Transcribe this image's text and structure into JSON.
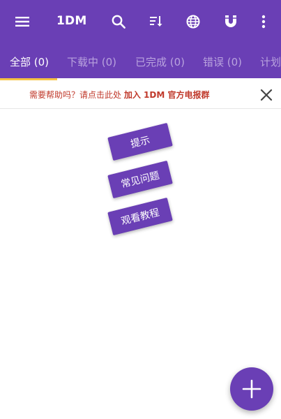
{
  "app": {
    "title": "1DM"
  },
  "toolbar": {
    "icons": [
      "menu-icon",
      "search-icon",
      "sort-icon",
      "browser-icon",
      "magnet-icon",
      "more-vert-icon"
    ]
  },
  "tabs": [
    {
      "label": "全部 (0)",
      "active": true
    },
    {
      "label": "下载中 (0)",
      "active": false
    },
    {
      "label": "已完成 (0)",
      "active": false
    },
    {
      "label": "错误 (0)",
      "active": false
    },
    {
      "label": "计划",
      "active": false
    }
  ],
  "help": {
    "text": "需要帮助吗？请点击此处",
    "link": "加入 1DM 官方电报群"
  },
  "hints": {
    "tips": "提示",
    "faq": "常见问题",
    "tutorial": "观看教程"
  },
  "colors": {
    "primary": "#6a3fb5",
    "tab_inactive": "#b9a3de",
    "indicator": "#f6c343",
    "help_text": "#c0392b"
  }
}
